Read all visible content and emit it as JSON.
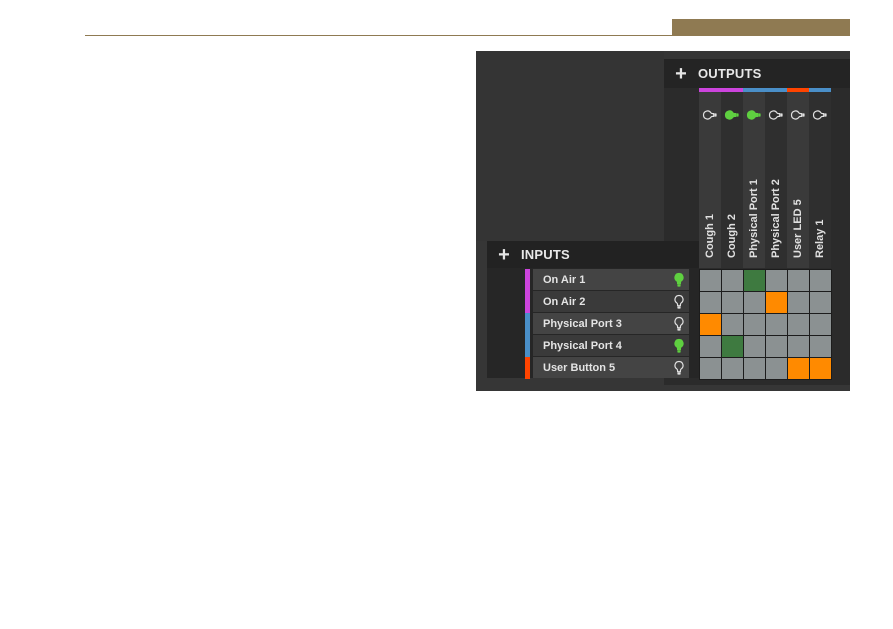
{
  "page": {
    "accent_color": "#8f7a52"
  },
  "matrix": {
    "outputs": {
      "add_symbol": "+",
      "title": "OUTPUTS",
      "columns": [
        {
          "label": "Cough 1",
          "group_color": "#cc44dd",
          "indicator": "off"
        },
        {
          "label": "Cough 2",
          "group_color": "#cc44dd",
          "indicator": "on"
        },
        {
          "label": "Physical Port 1",
          "group_color": "#4a8fc8",
          "indicator": "on"
        },
        {
          "label": "Physical Port 2",
          "group_color": "#4a8fc8",
          "indicator": "off"
        },
        {
          "label": "User LED 5",
          "group_color": "#ff4400",
          "indicator": "off"
        },
        {
          "label": "Relay 1",
          "group_color": "#4a8fc8",
          "indicator": "off"
        }
      ]
    },
    "inputs": {
      "add_symbol": "+",
      "title": "INPUTS",
      "rows": [
        {
          "label": "On Air 1",
          "group_color": "#cc44dd",
          "indicator": "on"
        },
        {
          "label": "On Air 2",
          "group_color": "#cc44dd",
          "indicator": "off"
        },
        {
          "label": "Physical Port 3",
          "group_color": "#4a8fc8",
          "indicator": "off"
        },
        {
          "label": "Physical Port 4",
          "group_color": "#4a8fc8",
          "indicator": "on"
        },
        {
          "label": "User Button 5",
          "group_color": "#ff4400",
          "indicator": "off"
        }
      ]
    },
    "cells": [
      [
        "none",
        "none",
        "green",
        "none",
        "none",
        "none"
      ],
      [
        "none",
        "none",
        "none",
        "orange",
        "none",
        "none"
      ],
      [
        "orange",
        "none",
        "none",
        "none",
        "none",
        "none"
      ],
      [
        "none",
        "green",
        "none",
        "none",
        "none",
        "none"
      ],
      [
        "none",
        "none",
        "none",
        "none",
        "orange",
        "orange"
      ]
    ],
    "colors": {
      "indicator_on": "#5fd040",
      "indicator_off": "#e0e0e0",
      "cell_idle": "#8b9192",
      "cell_green": "#3e7a40",
      "cell_orange": "#ff8a00"
    }
  }
}
